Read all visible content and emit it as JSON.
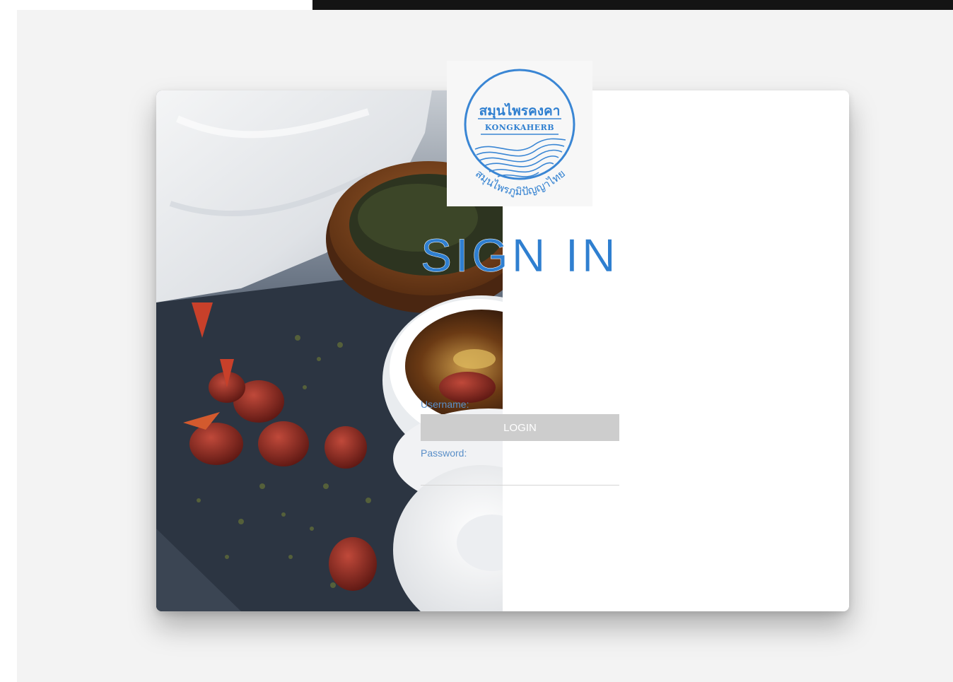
{
  "form": {
    "title": "SIGN IN",
    "username_label": "Username:",
    "username_value": "",
    "password_label": "Password:",
    "password_value": "",
    "login_label": "LOGIN"
  },
  "logo": {
    "thai_name": "สมุนไพรคงคา",
    "english_name": "KONGKAHERB",
    "thai_tagline": "สมุนไพรภูมิปัญญาไทย"
  },
  "colors": {
    "accent": "#2f7fd0",
    "label": "#5a8fc8",
    "button_bg": "#cdcdcd",
    "page_bg": "#f3f3f3",
    "top_bar": "#141414"
  },
  "photo": {
    "subject": "herbal tea with dried red dates on slate"
  }
}
